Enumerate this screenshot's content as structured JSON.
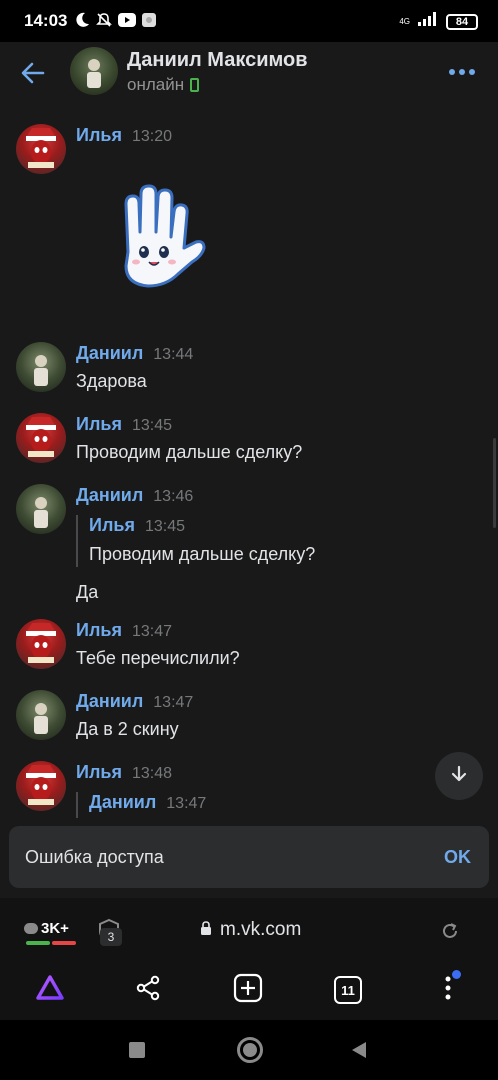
{
  "status_bar": {
    "time": "14:03",
    "network": "4G",
    "battery": "84"
  },
  "header": {
    "name": "Даниил Максимов",
    "status": "онлайн"
  },
  "messages": [
    {
      "author": "Илья",
      "time": "13:20",
      "sticker": "waving-hand-sticker"
    },
    {
      "author": "Даниил",
      "time": "13:44",
      "text": "Здарова"
    },
    {
      "author": "Илья",
      "time": "13:45",
      "text": "Проводим дальше сделку?"
    },
    {
      "author": "Даниил",
      "time": "13:46",
      "quote": {
        "author": "Илья",
        "time": "13:45",
        "text": "Проводим дальше сделку?"
      },
      "text": "Да"
    },
    {
      "author": "Илья",
      "time": "13:47",
      "text": "Тебе перечислили?"
    },
    {
      "author": "Даниил",
      "time": "13:47",
      "text": "Да в 2 скину"
    },
    {
      "author": "Илья",
      "time": "13:48",
      "quote": {
        "author": "Даниил",
        "time": "13:47"
      }
    }
  ],
  "toast": {
    "message": "Ошибка доступа",
    "action": "OK"
  },
  "browser": {
    "comments_badge": "3K+",
    "shield_count": "3",
    "url": "m.vk.com",
    "tabs_count": "11"
  },
  "colors": {
    "accent": "#71aaeb",
    "online": "#4bb34b",
    "background": "#19191a"
  }
}
